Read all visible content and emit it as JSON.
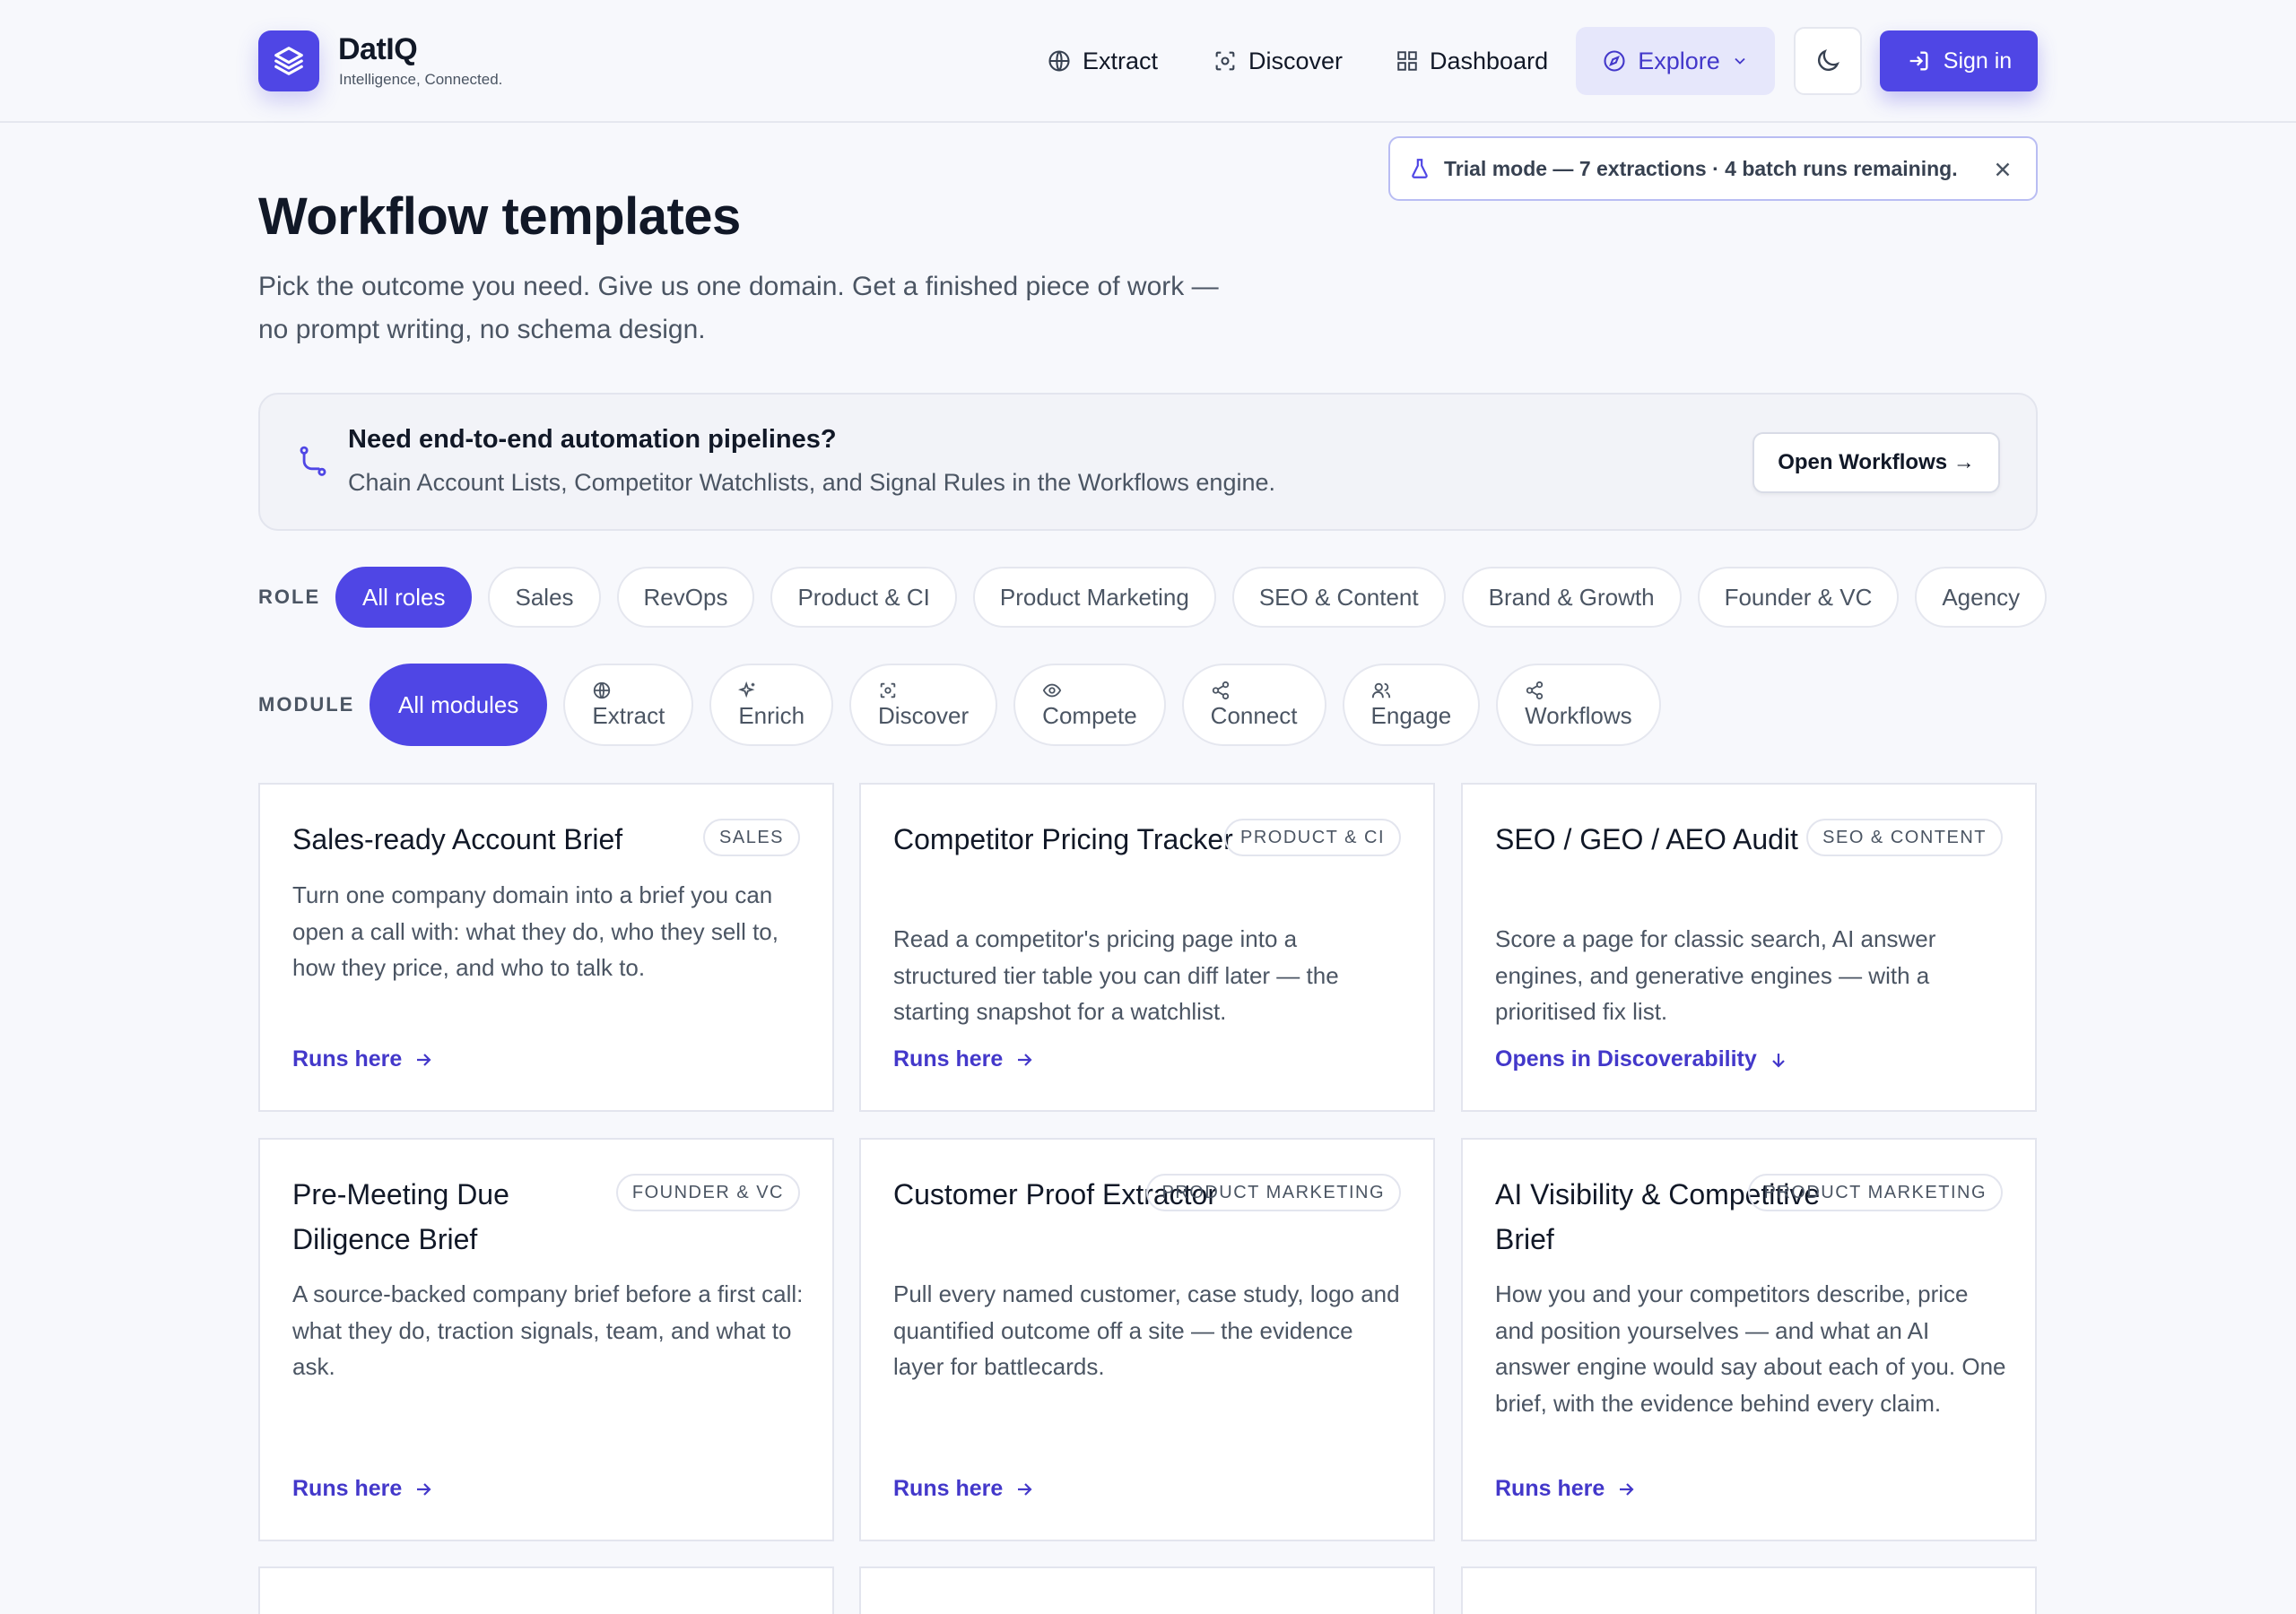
{
  "brand": {
    "name": "DatIQ",
    "tagline": "Intelligence, Connected."
  },
  "nav": {
    "extract": "Extract",
    "discover": "Discover",
    "dashboard": "Dashboard",
    "explore": "Explore",
    "sign_in": "Sign in"
  },
  "trial_banner": {
    "text": "Trial mode — 7 extractions · 4 batch runs remaining."
  },
  "page": {
    "title": "Workflow templates",
    "subtitle": "Pick the outcome you need. Give us one domain. Get a finished piece of work — no prompt writing, no schema design."
  },
  "callout": {
    "title": "Need end-to-end automation pipelines?",
    "text": "Chain Account Lists, Competitor Watchlists, and Signal Rules in the Workflows engine.",
    "button": "Open Workflows →"
  },
  "filters": {
    "role_label": "ROLE",
    "roles": [
      "All roles",
      "Sales",
      "RevOps",
      "Product & CI",
      "Product Marketing",
      "SEO & Content",
      "Brand & Growth",
      "Founder & VC",
      "Agency"
    ],
    "module_label": "MODULE",
    "modules": [
      {
        "label": "All modules",
        "icon": ""
      },
      {
        "label": "Extract",
        "icon": "globe-icon"
      },
      {
        "label": "Enrich",
        "icon": "sparkles-icon"
      },
      {
        "label": "Discover",
        "icon": "scan-icon"
      },
      {
        "label": "Compete",
        "icon": "eye-icon"
      },
      {
        "label": "Connect",
        "icon": "share-icon"
      },
      {
        "label": "Engage",
        "icon": "users-icon"
      },
      {
        "label": "Workflows",
        "icon": "share-icon"
      }
    ]
  },
  "cards": [
    {
      "title": "Sales-ready Account Brief",
      "badge": "SALES",
      "description": "Turn one company domain into a brief you can open a call with: what they do, who they sell to, how they price, and who to talk to.",
      "link": "Runs here"
    },
    {
      "title": "Competitor Pricing Tracker",
      "badge": "PRODUCT & CI",
      "description": "Read a competitor's pricing page into a structured tier table you can diff later — the starting snapshot for a watchlist.",
      "link": "Runs here"
    },
    {
      "title": "SEO / GEO / AEO Audit",
      "badge": "SEO & CONTENT",
      "description": "Score a page for classic search, AI answer engines, and generative engines — with a prioritised fix list.",
      "link": "Opens in Discoverability"
    },
    {
      "title": "Pre-Meeting Due Diligence Brief",
      "badge": "FOUNDER & VC",
      "description": "A source-backed company brief before a first call: what they do, traction signals, team, and what to ask.",
      "link": "Runs here"
    },
    {
      "title": "Customer Proof Extractor",
      "badge": "PRODUCT MARKETING",
      "description": "Pull every named customer, case study, logo and quantified outcome off a site — the evidence layer for battlecards.",
      "link": "Runs here"
    },
    {
      "title": "AI Visibility & Competitive Brief",
      "badge": "PRODUCT MARKETING",
      "description": "How you and your competitors describe, price and position yourselves — and what an AI answer engine would say about each of you. One brief, with the evidence behind every claim.",
      "link": "Runs here"
    }
  ],
  "colors": {
    "accent": "#4f46e5",
    "accent_text": "#4338ca",
    "background": "#f7f8fc"
  }
}
